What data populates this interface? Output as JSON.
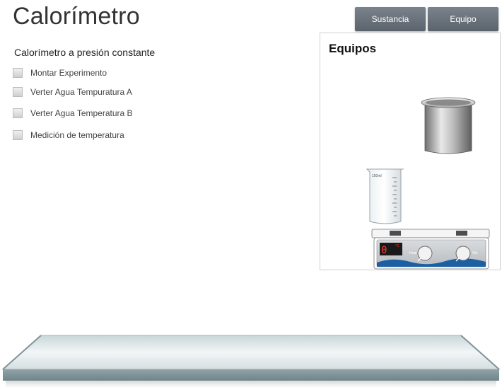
{
  "app": {
    "title": "Calorímetro"
  },
  "tabs": [
    {
      "label": "Sustancia"
    },
    {
      "label": "Equipo"
    }
  ],
  "procedure": {
    "title": "Calorímetro a presión constante",
    "steps": [
      {
        "label": "Montar Experimento",
        "checked": false
      },
      {
        "label": "Verter  Agua  Tempuratura A",
        "checked": false
      },
      {
        "label": "Verter  Agua  Temperatura B",
        "checked": false
      },
      {
        "label": "Medición de temperatura",
        "checked": false
      }
    ]
  },
  "equipment": {
    "title": "Equipos",
    "items": [
      {
        "icon": "calorimeter-cup-icon"
      },
      {
        "icon": "beaker-icon",
        "label": "150ml"
      },
      {
        "icon": "hot-plate-icon",
        "display": "0",
        "display_unit": "°C",
        "knobs": [
          "Heat",
          "Stir"
        ]
      }
    ]
  },
  "colors": {
    "tab_bg": "#667078",
    "display_text": "#ff3b2f",
    "bench_edge": "#8fa3a8",
    "water": "#1d5fa3"
  }
}
